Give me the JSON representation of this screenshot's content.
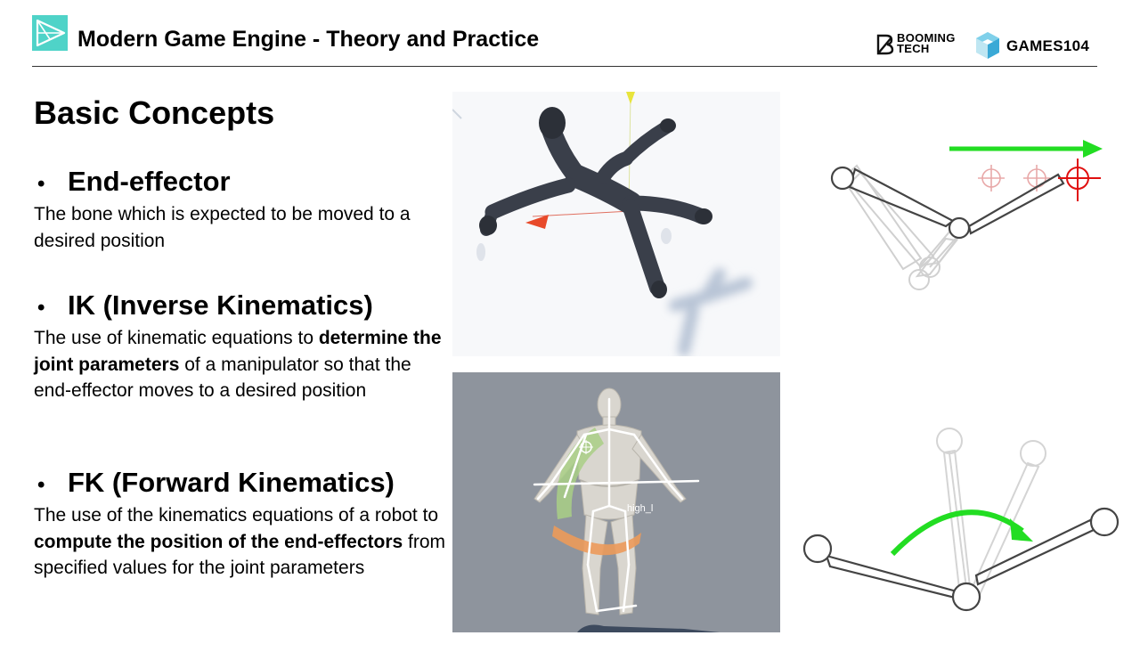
{
  "header": {
    "title": "Modern Game Engine - Theory and Practice",
    "brand_booming": "BOOMING\nTECH",
    "brand_games": "GAMES104"
  },
  "section_title": "Basic Concepts",
  "concepts": [
    {
      "bullet": "•",
      "title": "End-effector",
      "body": [
        {
          "text": "The bone which is expected to be moved to a desired position",
          "bold": false
        }
      ]
    },
    {
      "bullet": "•",
      "title": "IK (Inverse Kinematics)",
      "body": [
        {
          "text": "The use of kinematic equations to ",
          "bold": false
        },
        {
          "text": "determine the joint parameters",
          "bold": true
        },
        {
          "text": " of a manipulator so that the end-effector moves to a desired position",
          "bold": false
        }
      ]
    },
    {
      "bullet": "•",
      "title": "FK (Forward Kinematics)",
      "body": [
        {
          "text": "The use of the kinematics equations of a robot to ",
          "bold": false
        },
        {
          "text": "compute the position of the end-effectors",
          "bold": true
        },
        {
          "text": " from specified values for the joint parameters",
          "bold": false
        }
      ]
    }
  ],
  "figures": {
    "bone_label": "high_l"
  },
  "colors": {
    "accent_teal": "#4fd3c8",
    "arrow_green": "#22dd22",
    "target_red": "#e01010"
  }
}
